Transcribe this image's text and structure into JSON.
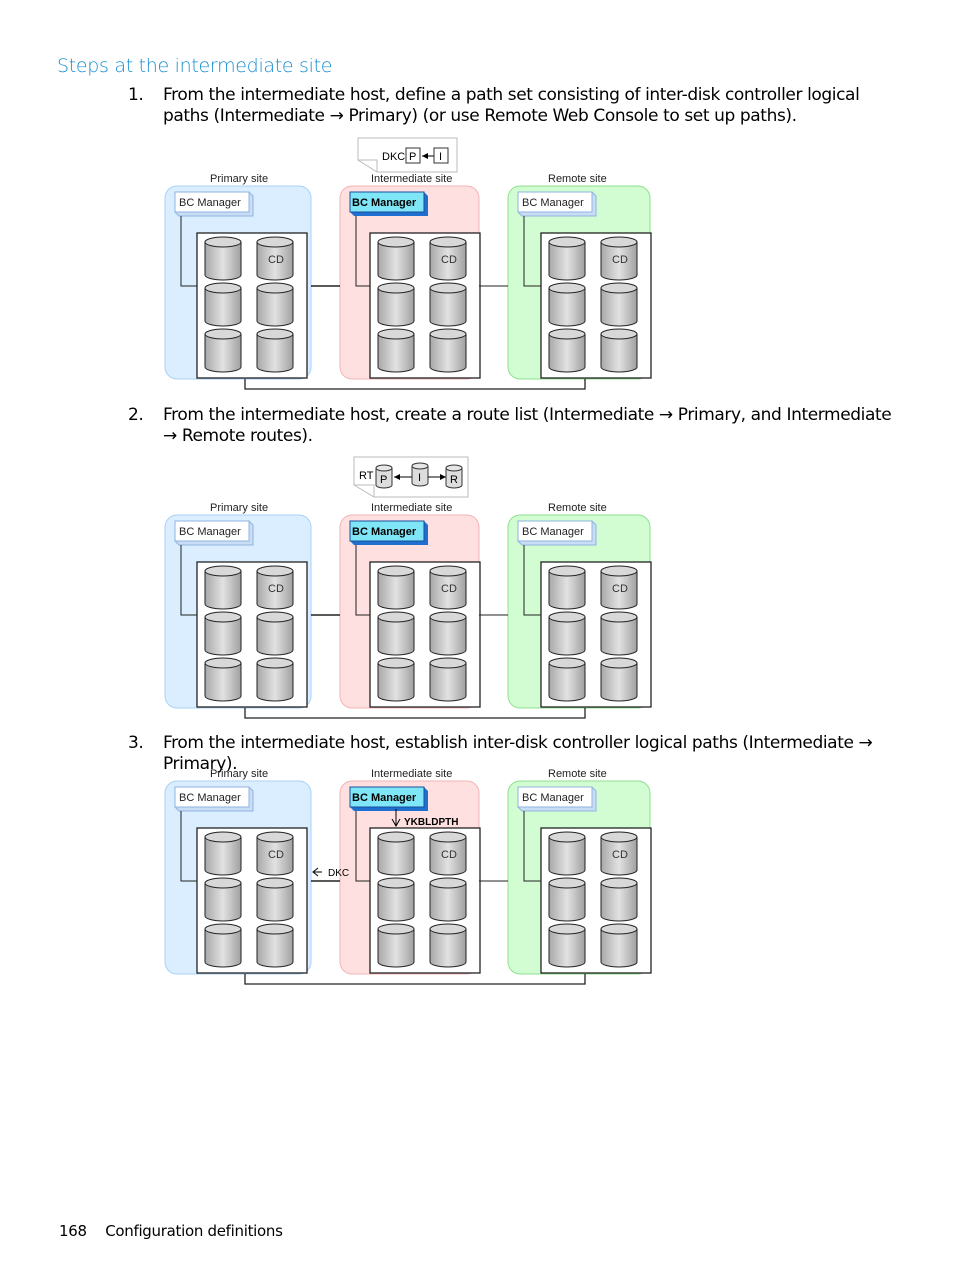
{
  "section": {
    "heading": "Steps at the intermediate site"
  },
  "steps": [
    {
      "number": "1.",
      "text": "From the intermediate host, define a path set consisting of inter-disk controller logical paths (Intermediate → Primary) (or use Remote Web Console to set up paths)."
    },
    {
      "number": "2.",
      "text": "From the intermediate host, create a route list (Intermediate → Primary, and Intermediate → Remote routes)."
    },
    {
      "number": "3.",
      "text": "From the intermediate host, establish inter-disk controller logical paths (Intermediate → Primary)."
    }
  ],
  "diagram_labels": {
    "primary_site": "Primary site",
    "intermediate_site": "Intermediate site",
    "remote_site": "Remote site",
    "bc_manager": "BC Manager",
    "cd": "CD"
  },
  "diagram1": {
    "callout_prefix": "DKC",
    "callout_from": "P",
    "callout_to": "I"
  },
  "diagram2": {
    "callout_prefix": "RT",
    "route_primary": "P",
    "route_intermediate": "I",
    "route_remote": "R"
  },
  "diagram3": {
    "command": "YKBLDPTH",
    "dkc_label": "DKC"
  },
  "colors": {
    "heading": "#1a8fd0",
    "primary_fill": "#dbeeff",
    "primary_stroke": "#a9d1f5",
    "intermediate_fill": "#ffe0e0",
    "intermediate_stroke": "#f3b4b4",
    "remote_fill": "#d2fdd2",
    "remote_stroke": "#8fe08f",
    "bc_active_fill": "#7fe6f7",
    "bc_active_shadow": "#1f6fd0"
  },
  "footer": {
    "page_number": "168",
    "chapter": "Configuration definitions"
  }
}
